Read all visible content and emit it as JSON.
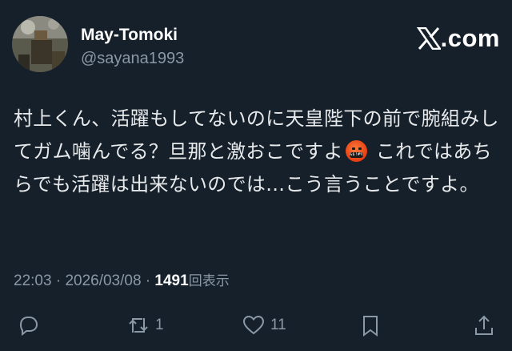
{
  "post": {
    "display_name": "May-Tomoki",
    "handle": "@sayana1993",
    "brand": ".com",
    "text_part1": "村上くん、活躍もしてないのに天皇陛下の前で腕組みしてガム噛んでる？旦那と激おこですよ",
    "emoji_label": "&$!#%",
    "text_part2": " これではあちらでも活躍は出来ないのでは…こう言うことですよ。",
    "time": "22:03",
    "separator": " · ",
    "date": "2026/03/08",
    "views_count": "1491",
    "views_label": "回表示"
  },
  "actions": {
    "reply_icon": "reply-icon",
    "retweet_icon": "retweet-icon",
    "retweet_count": "1",
    "like_icon": "heart-icon",
    "like_count": "11",
    "bookmark_icon": "bookmark-icon",
    "share_icon": "share-icon"
  },
  "colors": {
    "background": "#15202b",
    "text": "#e7e9ea",
    "muted": "#8b98a5"
  }
}
